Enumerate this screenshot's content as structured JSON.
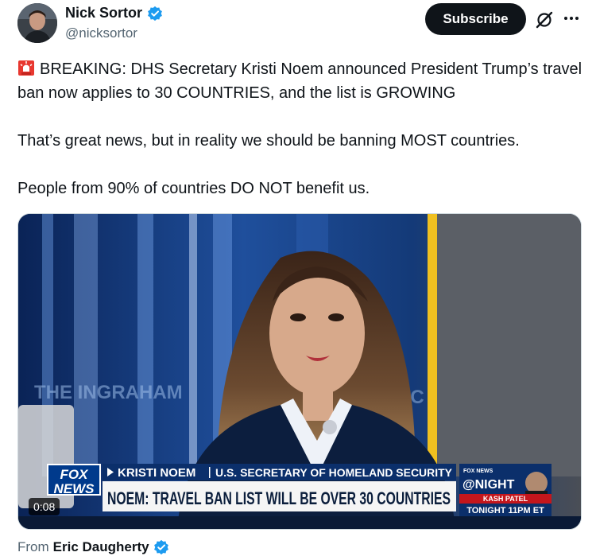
{
  "author": {
    "name": "Nick Sortor",
    "handle": "@nicksortor"
  },
  "actions": {
    "subscribe_label": "Subscribe",
    "grok_icon": "grok-icon",
    "more_icon": "more-icon"
  },
  "post": {
    "line1_emoji": "rotating-light",
    "paragraph1": "BREAKING: DHS Secretary Kristi Noem announced President Trump’s travel ban now applies to 30 COUNTRIES, and the list is GROWING",
    "paragraph2": "That’s great news, but in reality we should be banning MOST countries.",
    "paragraph3": "People from 90% of countries DO NOT benefit us."
  },
  "video": {
    "backdrop_text": "THE INGRAHAM",
    "backdrop_text_right": "NC",
    "lower_third_name": "KRISTI NOEM",
    "lower_third_title": "U.S. SECRETARY OF HOMELAND SECURITY",
    "headline": "NOEM: TRAVEL BAN LIST WILL BE OVER 30 COUNTRIES",
    "logo_line1": "FOX",
    "logo_line2": "NEWS",
    "promo_network": "FOX NEWS",
    "promo_show": "@NIGHT",
    "promo_guest": "KASH PATEL",
    "promo_time": "TONIGHT 11PM ET",
    "timestamp": "0:08"
  },
  "footer": {
    "from_label": "From",
    "source_name": "Eric Daugherty"
  },
  "colors": {
    "verified": "#1d9bf0",
    "fox_blue": "#003a8c",
    "headline_bg": "#f5f5f5",
    "nameplate_bg": "#0b2f6b"
  }
}
